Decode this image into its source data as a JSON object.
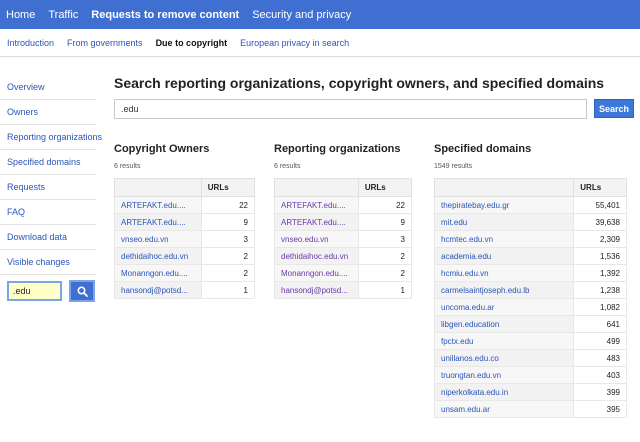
{
  "top_nav": [
    {
      "label": "Home"
    },
    {
      "label": "Traffic"
    },
    {
      "label": "Requests to remove content",
      "active": true
    },
    {
      "label": "Security and privacy"
    }
  ],
  "sub_nav": [
    {
      "label": "Introduction"
    },
    {
      "label": "From governments"
    },
    {
      "label": "Due to copyright",
      "active": true
    },
    {
      "label": "European privacy in search"
    }
  ],
  "sidebar": {
    "items": [
      "Overview",
      "Owners",
      "Reporting organizations",
      "Specified domains",
      "Requests",
      "FAQ",
      "Download data",
      "Visible changes"
    ],
    "search_value": ".edu"
  },
  "main": {
    "title": "Search reporting organizations, copyright owners, and specified domains",
    "search_value": ".edu",
    "search_button": "Search"
  },
  "columns": [
    {
      "title": "Copyright Owners",
      "count": "6 results",
      "header": "URLs",
      "rows": [
        {
          "name": "ARTEFAKT.edu....",
          "urls": "22"
        },
        {
          "name": "ARTEFAKT.edu....",
          "urls": "9"
        },
        {
          "name": "vnseo.edu.vn",
          "urls": "3"
        },
        {
          "name": "dethidaihoc.edu.vn",
          "urls": "2"
        },
        {
          "name": "Monanngon.edu....",
          "urls": "2"
        },
        {
          "name": "hansondj@potsd...",
          "urls": "1"
        }
      ]
    },
    {
      "title": "Reporting organizations",
      "count": "6 results",
      "header": "URLs",
      "rows": [
        {
          "name": "ARTEFAKT.edu....",
          "urls": "22"
        },
        {
          "name": "ARTEFAKT.edu....",
          "urls": "9"
        },
        {
          "name": "vnseo.edu.vn",
          "urls": "3"
        },
        {
          "name": "dethidaihoc.edu.vn",
          "urls": "2"
        },
        {
          "name": "Monanngon.edu....",
          "urls": "2"
        },
        {
          "name": "hansondj@potsd...",
          "urls": "1"
        }
      ]
    },
    {
      "title": "Specified domains",
      "count": "1549 results",
      "header": "URLs",
      "rows": [
        {
          "name": "thepiratebay.edu.gr",
          "urls": "55,401"
        },
        {
          "name": "mit.edu",
          "urls": "39,638"
        },
        {
          "name": "hcmtec.edu.vn",
          "urls": "2,309"
        },
        {
          "name": "academia.edu",
          "urls": "1,536"
        },
        {
          "name": "hcmiu.edu.vn",
          "urls": "1,392"
        },
        {
          "name": "carmelsaintjoseph.edu.lb",
          "urls": "1,238"
        },
        {
          "name": "uncoma.edu.ar",
          "urls": "1,082"
        },
        {
          "name": "libgen.education",
          "urls": "641"
        },
        {
          "name": "fpctx.edu",
          "urls": "499"
        },
        {
          "name": "unillanos.edu.co",
          "urls": "483"
        },
        {
          "name": "truongtan.edu.vn",
          "urls": "403"
        },
        {
          "name": "niperkolkata.edu.in",
          "urls": "399"
        },
        {
          "name": "unsam.edu.ar",
          "urls": "395"
        }
      ]
    }
  ]
}
